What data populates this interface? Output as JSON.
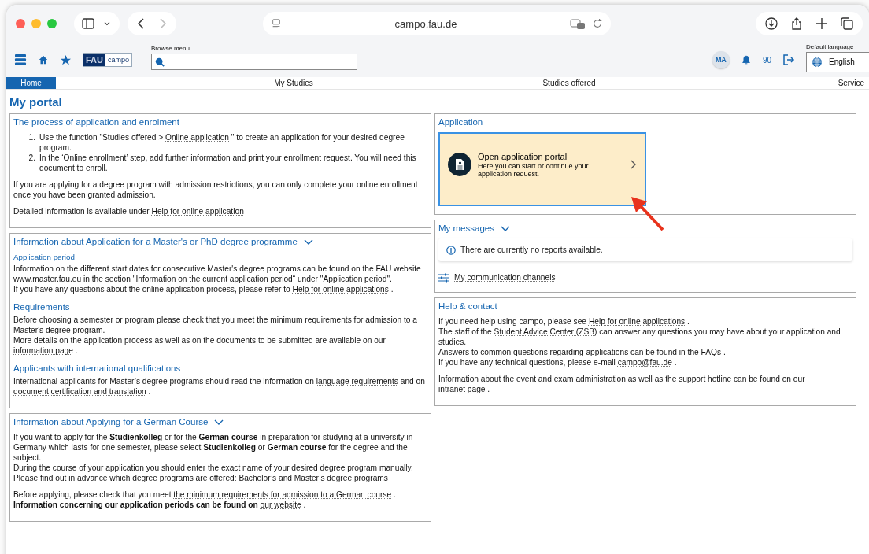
{
  "browser": {
    "url": "campo.fau.de"
  },
  "header": {
    "logo_mark": "FAU",
    "logo_text": "campo",
    "search_label": "Browse menu",
    "avatar": "MA",
    "notification_count": "90",
    "language_label": "Default language",
    "language": "English"
  },
  "nav": [
    {
      "label": "Home",
      "selected": true
    },
    {
      "label": "My Studies",
      "selected": false
    },
    {
      "label": "Studies offered",
      "selected": false
    },
    {
      "label": "Service",
      "selected": false
    }
  ],
  "page_title": "My portal",
  "left_panels": [
    {
      "title": "The process of application and enrolment",
      "blocks": [
        {
          "kind": "list",
          "items": [
            {
              "marker": "1.",
              "parts": [
                {
                  "kind": "text",
                  "text": "Use the function \"Studies offered > "
                },
                {
                  "kind": "link",
                  "text": "Online application"
                },
                {
                  "kind": "text",
                  "text": " \" to create an application for your desired degree program."
                }
              ]
            },
            {
              "marker": "2.",
              "parts": [
                {
                  "kind": "text",
                  "text": "In the ‘Online enrollment’ step, add further information and print your enrollment request. You will need this document to enroll."
                }
              ]
            }
          ]
        },
        {
          "kind": "paragraph",
          "parts": [
            {
              "kind": "text",
              "text": "If you are applying for a degree program with admission restrictions, you can only complete your online enrollment once you have been granted admission."
            }
          ]
        },
        {
          "kind": "paragraph",
          "parts": [
            {
              "kind": "text",
              "text": "Detailed information is available under "
            },
            {
              "kind": "link",
              "text": "Help for online application"
            }
          ]
        }
      ]
    },
    {
      "title": "Information about Application for a Master's or PhD degree programme",
      "expanded": true,
      "blocks": [
        {
          "kind": "subheading",
          "text": "Application period"
        },
        {
          "kind": "paragraph",
          "parts": [
            {
              "kind": "text",
              "text": "Information on the different start dates for consecutive Master's degree programs can be found on the FAU website "
            },
            {
              "kind": "link",
              "text": "www.master.fau.eu"
            },
            {
              "kind": "text",
              "text": " in the section \"Information on the current application period“ under \"Application period\"."
            },
            {
              "kind": "br"
            },
            {
              "kind": "text",
              "text": "If you have any questions about the online application process, please refer to "
            },
            {
              "kind": "link",
              "text": "Help for online applications"
            },
            {
              "kind": "text",
              "text": " ."
            }
          ]
        },
        {
          "kind": "heading",
          "text": "Requirements"
        },
        {
          "kind": "paragraph",
          "parts": [
            {
              "kind": "text",
              "text": "Before choosing a semester or program please check that you meet the minimum requirements for admission to a Master's degree program."
            },
            {
              "kind": "br"
            },
            {
              "kind": "text",
              "text": "More details on the application process as well as on the documents to be submitted are available on our "
            },
            {
              "kind": "link",
              "text": "information page"
            },
            {
              "kind": "text",
              "text": " ."
            }
          ]
        },
        {
          "kind": "heading",
          "text": "Applicants with international qualifications"
        },
        {
          "kind": "paragraph",
          "parts": [
            {
              "kind": "text",
              "text": "International applicants for Master’s degree programs should read the information on "
            },
            {
              "kind": "link",
              "text": "language requirements"
            },
            {
              "kind": "text",
              "text": " and on "
            },
            {
              "kind": "link",
              "text": "document certification and translation"
            },
            {
              "kind": "text",
              "text": " ."
            }
          ]
        }
      ]
    },
    {
      "title": "Information about Applying for a German Course",
      "expanded": true,
      "blocks": [
        {
          "kind": "paragraph",
          "parts": [
            {
              "kind": "text",
              "text": "If you want to apply for the **Studienkolleg** or for the **German course** in preparation for studying at a university in Germany which lasts for one semester, please select **Studienkolleg** or **German course** for the degree and the subject."
            },
            {
              "kind": "br"
            },
            {
              "kind": "text",
              "text": "During the course of your application you should enter the exact name of your desired degree program manually."
            },
            {
              "kind": "br"
            },
            {
              "kind": "text",
              "text": "Please find out in advance which degree programs are offered: "
            },
            {
              "kind": "link",
              "text": "Bachelor’s"
            },
            {
              "kind": "text",
              "text": " and "
            },
            {
              "kind": "link",
              "text": "Master’s"
            },
            {
              "kind": "text",
              "text": " degree programs"
            }
          ]
        },
        {
          "kind": "paragraph",
          "parts": [
            {
              "kind": "text",
              "text": "Before applying, please check that you meet "
            },
            {
              "kind": "link",
              "text": "the minimum requirements for admission to a German course"
            },
            {
              "kind": "text",
              "text": " ."
            },
            {
              "kind": "br"
            },
            {
              "kind": "text",
              "text": "**Information concerning our application periods can be found on** "
            },
            {
              "kind": "link",
              "text": "our website"
            },
            {
              "kind": "text",
              "text": " ."
            }
          ]
        }
      ]
    }
  ],
  "right_panels": [
    {
      "title": "Application",
      "blocks": [
        {
          "kind": "portal_card",
          "title": "Open application portal",
          "text": "Here you can start or continue your application request."
        }
      ]
    },
    {
      "title": "My messages",
      "expanded": true,
      "blocks": [
        {
          "kind": "notice",
          "text": "There are currently no reports available."
        },
        {
          "kind": "settings_link",
          "text": "My communication channels"
        }
      ]
    },
    {
      "title": "Help & contact",
      "blocks": [
        {
          "kind": "paragraph",
          "parts": [
            {
              "kind": "text",
              "text": "If you need help using campo, please see "
            },
            {
              "kind": "link",
              "text": "Help for online applications"
            },
            {
              "kind": "text",
              "text": " ."
            },
            {
              "kind": "br"
            },
            {
              "kind": "text",
              "text": "The staff of the "
            },
            {
              "kind": "link",
              "text": "Student Advice Center (ZSB)"
            },
            {
              "kind": "text",
              "text": " can answer any questions you may have about your application and studies."
            },
            {
              "kind": "br"
            },
            {
              "kind": "text",
              "text": "Answers to common questions regarding applications can be found in the "
            },
            {
              "kind": "link",
              "text": "FAQs"
            },
            {
              "kind": "text",
              "text": " ."
            },
            {
              "kind": "br"
            },
            {
              "kind": "text",
              "text": "If you have any technical questions, please e-mail "
            },
            {
              "kind": "link",
              "text": "campo@fau.de"
            },
            {
              "kind": "text",
              "text": " ."
            }
          ]
        },
        {
          "kind": "paragraph",
          "parts": [
            {
              "kind": "text",
              "text": "Information about the event and exam administration as well as the support hotline can be found on our "
            },
            {
              "kind": "link",
              "text": "intranet page"
            },
            {
              "kind": "text",
              "text": " ."
            }
          ]
        }
      ]
    }
  ]
}
